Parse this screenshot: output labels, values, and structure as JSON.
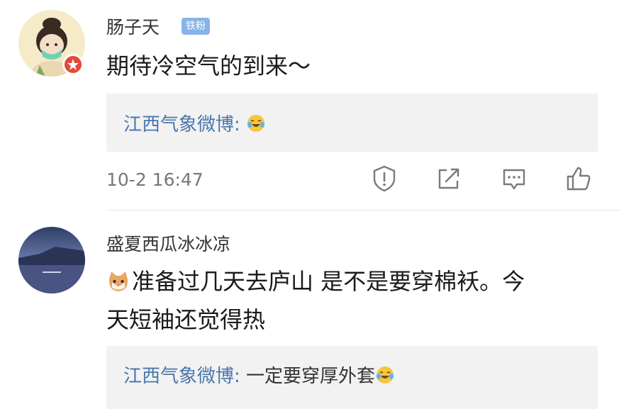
{
  "comments": [
    {
      "username": "肠子天",
      "badge": "铁粉",
      "text_lines": [
        "期待冷空气的到来～"
      ],
      "reply": {
        "author": "江西气象微博:",
        "content": ""
      },
      "timestamp": "10-2 16:47",
      "actions": [
        "report-icon",
        "share-icon",
        "comment-icon",
        "like-icon"
      ]
    },
    {
      "username": "盛夏西瓜冰冰凉",
      "text_lines": [
        "准备过几天去庐山 是不是要穿棉袄。今",
        "天短袖还觉得热"
      ],
      "reply": {
        "author": "江西气象微博:",
        "content": " 一定要穿厚外套"
      }
    }
  ],
  "colors": {
    "link_blue": "#4a77ad",
    "badge_blue": "#86b4e8",
    "reply_bg": "#f2f2f2",
    "meta_gray": "#777777",
    "icon_gray": "#7a7a7a"
  }
}
